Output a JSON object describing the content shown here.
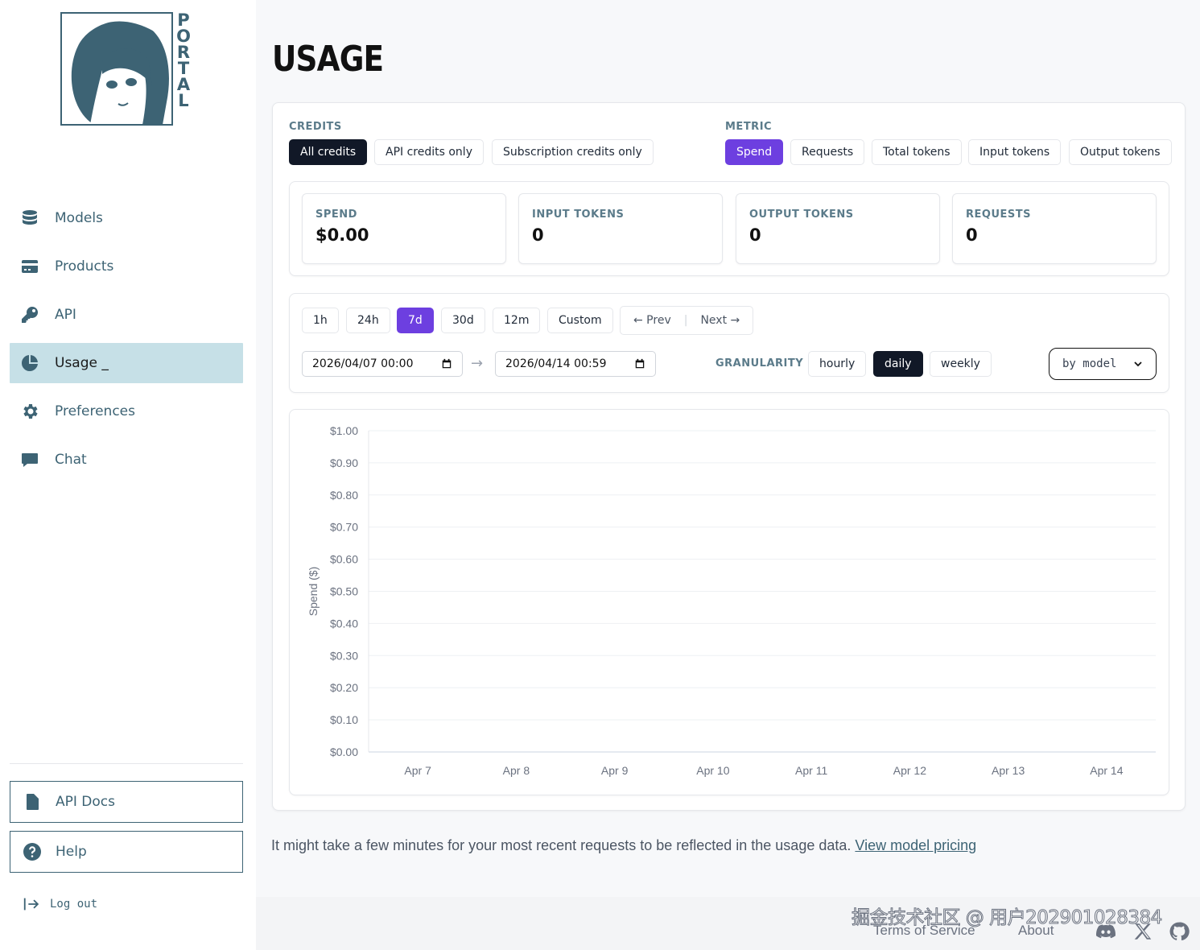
{
  "logo": {
    "letters": [
      "P",
      "O",
      "R",
      "T",
      "A",
      "L"
    ]
  },
  "sidebar": {
    "items": [
      {
        "label": "Models",
        "icon": "database-icon",
        "active": false
      },
      {
        "label": "Products",
        "icon": "credit-card-icon",
        "active": false
      },
      {
        "label": "API",
        "icon": "key-icon",
        "active": false
      },
      {
        "label": "Usage _",
        "icon": "pie-chart-icon",
        "active": true
      },
      {
        "label": "Preferences",
        "icon": "gear-icon",
        "active": false
      },
      {
        "label": "Chat",
        "icon": "chat-bubble-icon",
        "active": false
      }
    ],
    "api_docs": "API Docs",
    "help": "Help",
    "logout": "Log out"
  },
  "page": {
    "title": "USAGE"
  },
  "credits": {
    "label": "CREDITS",
    "options": [
      "All credits",
      "API credits only",
      "Subscription credits only"
    ],
    "selected": "All credits"
  },
  "metric": {
    "label": "METRIC",
    "options": [
      "Spend",
      "Requests",
      "Total tokens",
      "Input tokens",
      "Output tokens"
    ],
    "selected": "Spend"
  },
  "stats": [
    {
      "label": "SPEND",
      "value": "$0.00"
    },
    {
      "label": "INPUT TOKENS",
      "value": "0"
    },
    {
      "label": "OUTPUT TOKENS",
      "value": "0"
    },
    {
      "label": "REQUESTS",
      "value": "0"
    }
  ],
  "ranges": {
    "options": [
      "1h",
      "24h",
      "7d",
      "30d",
      "12m",
      "Custom"
    ],
    "selected": "7d"
  },
  "pager": {
    "prev": "← Prev",
    "separator": "|",
    "next": "Next →"
  },
  "date_from": "2026/04/07 00:00",
  "date_to": "2026/04/14 00:59",
  "date_arrow": "→",
  "granularity": {
    "label": "GRANULARITY",
    "options": [
      "hourly",
      "daily",
      "weekly"
    ],
    "selected": "daily"
  },
  "group_by": {
    "value": "by model"
  },
  "chart_data": {
    "type": "line",
    "title": "",
    "xlabel": "",
    "ylabel": "Spend ($)",
    "categories": [
      "Apr 7",
      "Apr 8",
      "Apr 9",
      "Apr 10",
      "Apr 11",
      "Apr 12",
      "Apr 13",
      "Apr 14"
    ],
    "y_ticks": [
      "$0.00",
      "$0.10",
      "$0.20",
      "$0.30",
      "$0.40",
      "$0.50",
      "$0.60",
      "$0.70",
      "$0.80",
      "$0.90",
      "$1.00"
    ],
    "ylim": [
      0,
      1
    ],
    "series": [],
    "grid": true
  },
  "note": {
    "text": "It might take a few minutes for your most recent requests to be reflected in the usage data.",
    "link": "View model pricing"
  },
  "footer": {
    "watermark": "掘金技术社区 @ 用户202901028384",
    "terms": "Terms of Service",
    "about": "About",
    "icons": [
      "discord-icon",
      "x-icon",
      "github-icon"
    ]
  },
  "colors": {
    "accent": "#6d3fe0",
    "brand": "#3d6374",
    "active_nav": "#c6e0e7",
    "dark": "#111827"
  }
}
